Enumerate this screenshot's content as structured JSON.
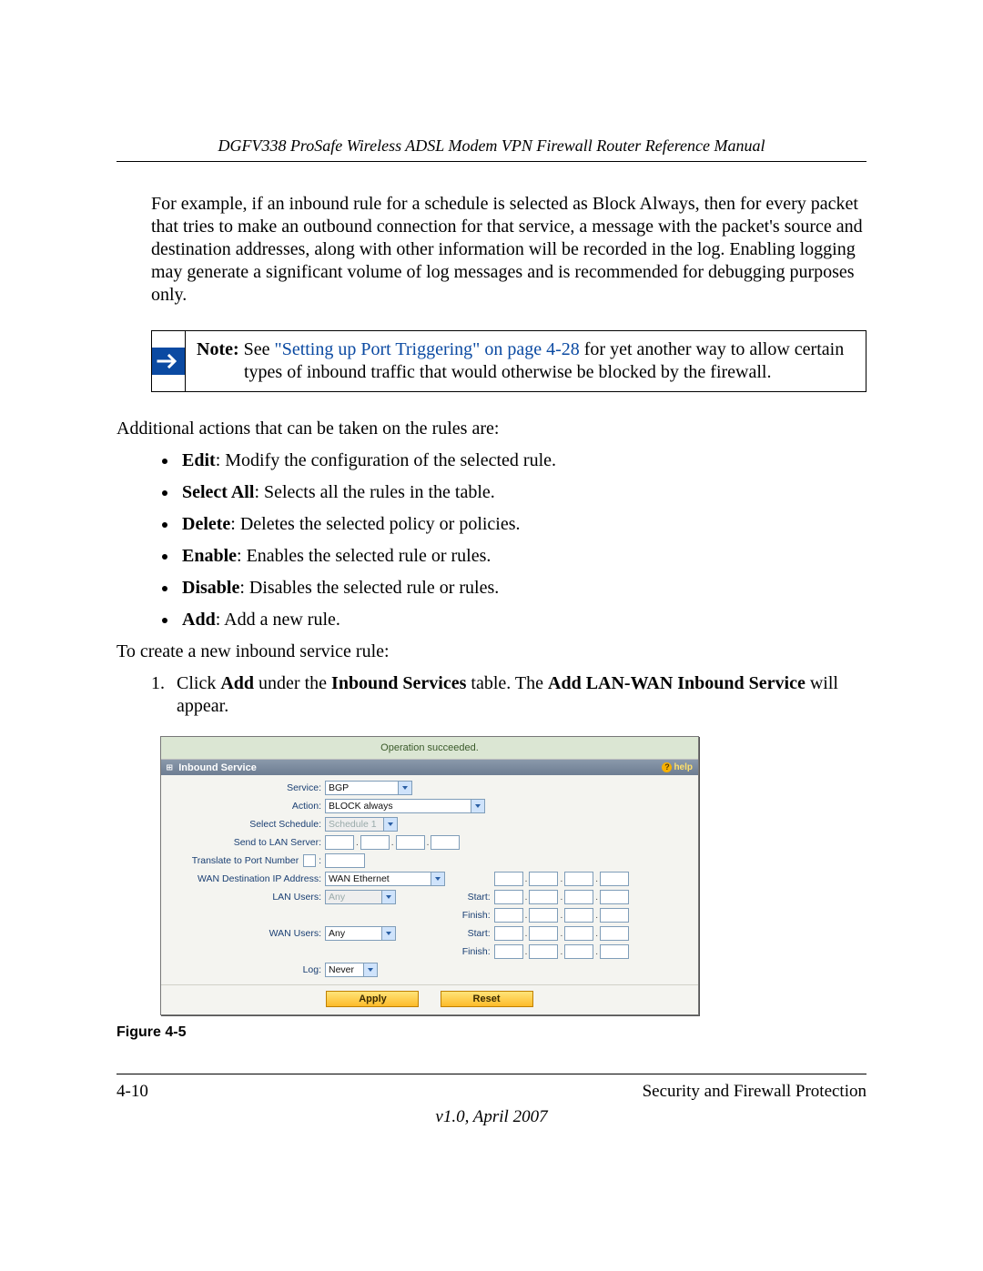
{
  "header": {
    "title": "DGFV338 ProSafe Wireless ADSL Modem VPN Firewall Router Reference Manual"
  },
  "paragraphs": {
    "intro": "For example, if an inbound rule for a schedule is selected as Block Always, then for every packet that tries to make an outbound connection for that service, a message with the packet's source and destination addresses, along with other information will be recorded in the log. Enabling logging may generate a significant volume of log messages and is recommended for debugging purposes only.",
    "additional": "Additional actions that can be taken on the rules are:",
    "create": "To create a new inbound service rule:"
  },
  "note": {
    "prefix": "Note:",
    "before_link": " See ",
    "link": "\"Setting up Port Triggering\" on page 4-28",
    "after_link": " for yet another way to allow certain types of inbound traffic that would otherwise be blocked by the firewall."
  },
  "actions": [
    {
      "term": "Edit",
      "desc": ": Modify the configuration of the selected rule."
    },
    {
      "term": "Select All",
      "desc": ": Selects all the rules in the table."
    },
    {
      "term": "Delete",
      "desc": ": Deletes the selected policy or policies."
    },
    {
      "term": "Enable",
      "desc": ": Enables the selected rule or rules."
    },
    {
      "term": "Disable",
      "desc": ": Disables the selected rule or rules."
    },
    {
      "term": "Add",
      "desc": ": Add a new rule."
    }
  ],
  "step1": {
    "p1": "Click ",
    "b1": "Add",
    "p2": " under the ",
    "b2": "Inbound Services",
    "p3": " table. The ",
    "b3": "Add LAN-WAN Inbound Service",
    "p4": " will appear."
  },
  "ui": {
    "status": "Operation succeeded.",
    "section": "Inbound Service",
    "help": "help",
    "labels": {
      "service": "Service:",
      "action": "Action:",
      "schedule": "Select Schedule:",
      "send": "Send to LAN Server:",
      "translate": "Translate to Port Number",
      "wandest": "WAN Destination IP Address:",
      "lanusers": "LAN Users:",
      "wanusers": "WAN Users:",
      "log": "Log:",
      "start": "Start:",
      "finish": "Finish:"
    },
    "values": {
      "service": "BGP",
      "action": "BLOCK always",
      "schedule": "Schedule 1",
      "wandest": "WAN Ethernet",
      "lanusers": "Any",
      "wanusers": "Any",
      "log": "Never"
    },
    "buttons": {
      "apply": "Apply",
      "reset": "Reset"
    }
  },
  "figure": "Figure 4-5",
  "footer": {
    "left": "4-10",
    "right": "Security and Firewall Protection",
    "center": "v1.0, April 2007"
  }
}
